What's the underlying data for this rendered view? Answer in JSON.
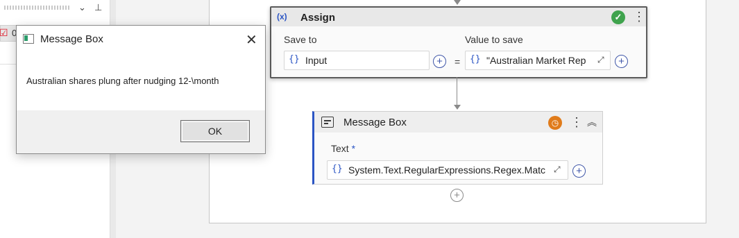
{
  "dialog": {
    "title": "Message Box",
    "message": "Australian shares plung after nudging 12-\\month",
    "ok_label": "OK"
  },
  "left_panel": {
    "row_count": "0"
  },
  "assign": {
    "title": "Assign",
    "save_to_label": "Save to",
    "value_label": "Value to save",
    "save_to_value": "Input",
    "value": "\"Australian Market Rep",
    "equals": "="
  },
  "message_box_activity": {
    "title": "Message Box",
    "text_label": "Text",
    "required_mark": "*",
    "text_value": "System.Text.RegularExpressions.Regex.Matc"
  },
  "icons": {
    "brace": "{}",
    "plus": "+",
    "kebab": "⋮",
    "expand": "⤢",
    "collapse": "⌃",
    "close": "✕",
    "check": "✓",
    "clock": "◷",
    "chevron": "⌄",
    "pin": "⊥"
  },
  "colors": {
    "accent": "#2b55c4",
    "success": "#3fa34d",
    "warning": "#e07b1a"
  }
}
